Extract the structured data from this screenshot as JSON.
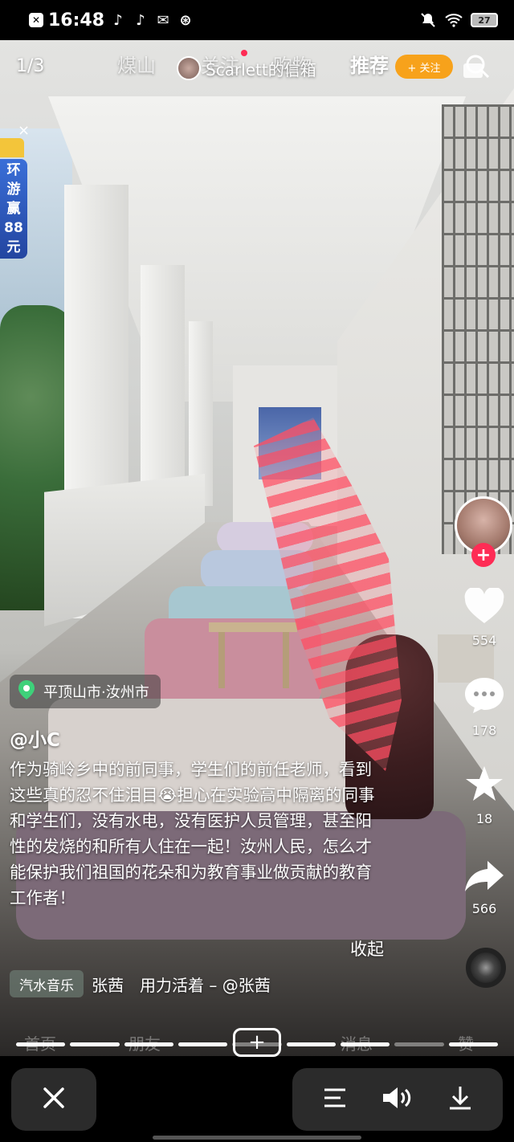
{
  "status_bar": {
    "time": "16:48",
    "battery": "27"
  },
  "top_nav": {
    "page_counter": "1/3",
    "tabs": [
      {
        "label": "煤山"
      },
      {
        "label": "关注"
      },
      {
        "label": "购物"
      },
      {
        "label": "推荐"
      }
    ],
    "source_label": "Scarlett的信箱",
    "follow_label": "+ 关注"
  },
  "ad": {
    "close": "×",
    "lines": [
      "环",
      "游",
      "赢",
      "88",
      "元"
    ]
  },
  "actions": {
    "likes": "554",
    "comments": "178",
    "favorites": "18",
    "shares": "566",
    "follow_plus": "+"
  },
  "caption": {
    "location": "平顶山市·汝州市",
    "author": "@小C",
    "text": "作为骑岭乡中的前同事，学生们的前任老师，看到这些真的忍不住泪目😭担心在实验高中隔离的同事和学生们，没有水电，没有医护人员管理，甚至阳性的发烧的和所有人住在一起！汝州人民，怎么才能保护我们祖国的花朵和为教育事业做贡献的教育工作者！",
    "collapse": "收起",
    "music_tag": "汽水音乐",
    "music_text": "张茜　用力活着 – @张茜"
  },
  "bottom_nav": {
    "home": "首页",
    "friends": "朋友",
    "add": "+",
    "messages": "消息",
    "me": "赞"
  },
  "colors": {
    "accent_red": "#fe2c55",
    "follow_orange": "#f7a21b",
    "control_bg": "#2b2b2b"
  }
}
